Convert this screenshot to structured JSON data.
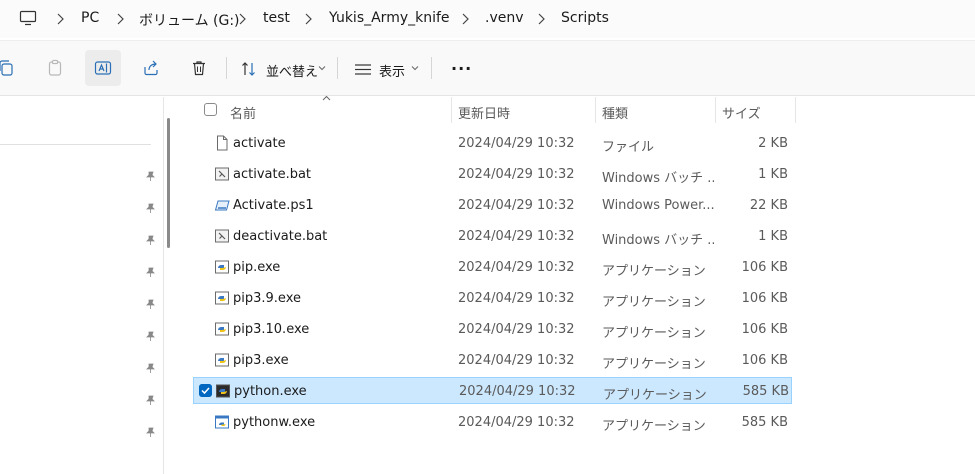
{
  "breadcrumb": {
    "items": [
      "PC",
      "ボリューム (G:)",
      "test",
      "Yukis_Army_knife",
      ".venv",
      "Scripts"
    ]
  },
  "toolbar": {
    "sort_label": "並べ替え",
    "view_label": "表示",
    "more_label": "..."
  },
  "columns": {
    "name": "名前",
    "date": "更新日時",
    "type": "種類",
    "size": "サイズ"
  },
  "files": [
    {
      "name": "activate",
      "date": "2024/04/29 10:32",
      "type": "ファイル",
      "size": "2 KB",
      "icon": "file-icon"
    },
    {
      "name": "activate.bat",
      "date": "2024/04/29 10:32",
      "type": "Windows バッチ ...",
      "size": "1 KB",
      "icon": "batch-file-icon"
    },
    {
      "name": "Activate.ps1",
      "date": "2024/04/29 10:32",
      "type": "Windows Power...",
      "size": "22 KB",
      "icon": "powershell-file-icon"
    },
    {
      "name": "deactivate.bat",
      "date": "2024/04/29 10:32",
      "type": "Windows バッチ ...",
      "size": "1 KB",
      "icon": "batch-file-icon"
    },
    {
      "name": "pip.exe",
      "date": "2024/04/29 10:32",
      "type": "アプリケーション",
      "size": "106 KB",
      "icon": "python-exe-icon"
    },
    {
      "name": "pip3.9.exe",
      "date": "2024/04/29 10:32",
      "type": "アプリケーション",
      "size": "106 KB",
      "icon": "python-exe-icon"
    },
    {
      "name": "pip3.10.exe",
      "date": "2024/04/29 10:32",
      "type": "アプリケーション",
      "size": "106 KB",
      "icon": "python-exe-icon"
    },
    {
      "name": "pip3.exe",
      "date": "2024/04/29 10:32",
      "type": "アプリケーション",
      "size": "106 KB",
      "icon": "python-exe-icon"
    },
    {
      "name": "python.exe",
      "date": "2024/04/29 10:32",
      "type": "アプリケーション",
      "size": "585 KB",
      "icon": "python-console-icon",
      "selected": true
    },
    {
      "name": "pythonw.exe",
      "date": "2024/04/29 10:32",
      "type": "アプリケーション",
      "size": "585 KB",
      "icon": "python-window-icon"
    }
  ],
  "colors": {
    "selection_bg": "#cce8ff",
    "selection_border": "#99d1ff",
    "accent": "#0067c0"
  }
}
